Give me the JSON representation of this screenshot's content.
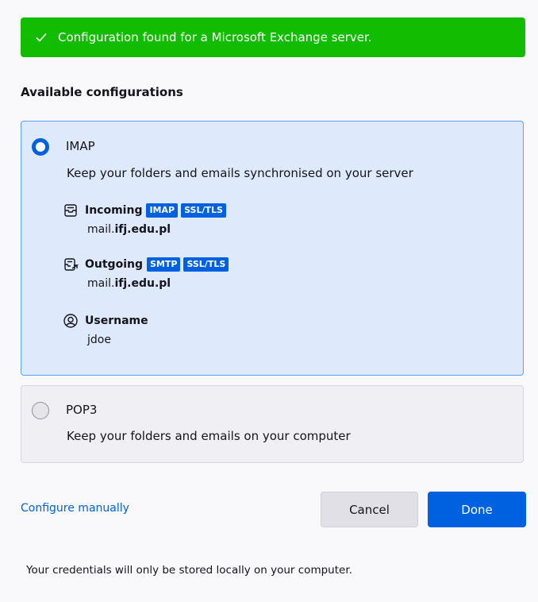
{
  "banner": {
    "text": "Configuration found for a Microsoft Exchange server.",
    "icon": "check-icon",
    "color": "#12bc00"
  },
  "heading": "Available configurations",
  "options": [
    {
      "title": "IMAP",
      "description": "Keep your folders and emails synchronised on your server",
      "selected": true,
      "incoming": {
        "label": "Incoming",
        "badges": [
          "IMAP",
          "SSL/TLS"
        ],
        "host_prefix": "mail.",
        "host_bold": "ifj.edu.pl"
      },
      "outgoing": {
        "label": "Outgoing",
        "badges": [
          "SMTP",
          "SSL/TLS"
        ],
        "host_prefix": "mail.",
        "host_bold": "ifj.edu.pl"
      },
      "username": {
        "label": "Username",
        "value": "jdoe"
      }
    },
    {
      "title": "POP3",
      "description": "Keep your folders and emails on your computer",
      "selected": false
    }
  ],
  "actions": {
    "configure_manually": "Configure manually",
    "cancel": "Cancel",
    "done": "Done"
  },
  "footer": "Your credentials will only be stored locally on your computer.",
  "colors": {
    "accent": "#0061e0",
    "selected_bg": "#deeafc",
    "selected_border": "#5aa1f5"
  }
}
